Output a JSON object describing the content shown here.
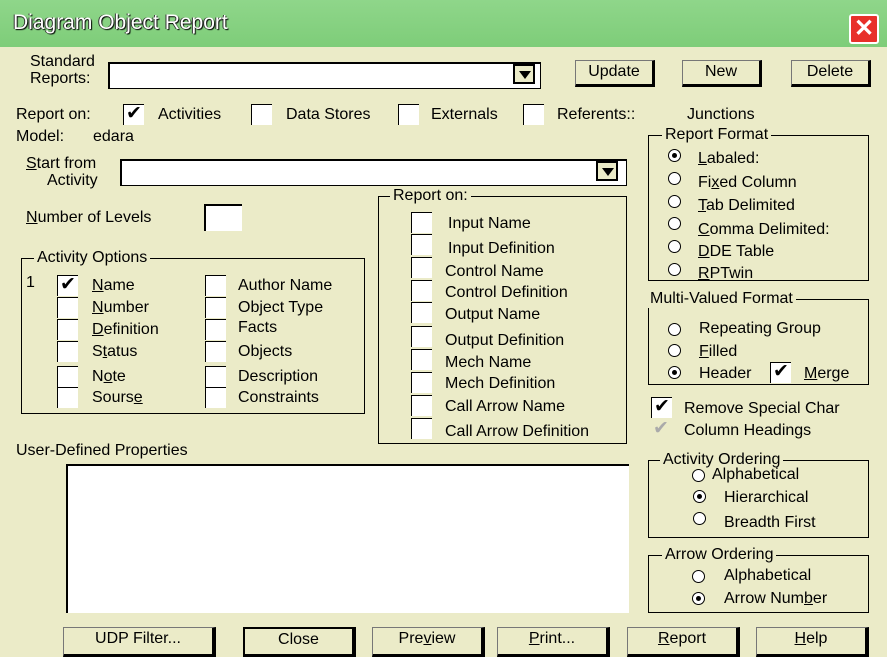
{
  "window": {
    "title": "Diagram Object Report",
    "close": "✕"
  },
  "standard_reports": {
    "label1": "Standard",
    "label2": "Reports:",
    "value": ""
  },
  "buttons_top": {
    "update": "Update",
    "new": "New",
    "delete": "Delete"
  },
  "report_on_row": {
    "label": "Report on:",
    "activities": "Activities",
    "data_stores": "Data Stores",
    "externals": "Externals",
    "referents": "Referents::",
    "junctions": "Junctions"
  },
  "model": {
    "label": "Model:",
    "value": "edara"
  },
  "start_from": {
    "label1": "Start from",
    "label2": "Activity",
    "value": ""
  },
  "levels": {
    "label": "Number of Levels",
    "value": ""
  },
  "activity_options": {
    "legend": "Activity Options",
    "marker": "1",
    "left": [
      "Name",
      "Number",
      "Definition",
      "Status",
      "Note",
      "Sourse"
    ],
    "right": [
      "Author Name",
      "Object Type",
      "Facts",
      "Objects",
      "Description",
      "Constraints"
    ]
  },
  "report_on_box": {
    "legend": "Report on:",
    "items": [
      "Input Name",
      "Input Definition",
      "Control Name",
      "Control Definition",
      "Output Name",
      "Output Definition",
      "Mech Name",
      "Mech Definition",
      "Call Arrow Name",
      "Call Arrow Definition"
    ]
  },
  "report_format": {
    "legend": "Report Format",
    "options": [
      "Labaled:",
      "Fixed Column",
      "Tab Delimited",
      "Comma Delimited:",
      "DDE Table",
      "RPTwin"
    ],
    "selected": 0
  },
  "multi_valued": {
    "legend": "Multi-Valued Format",
    "options": [
      "Repeating Group",
      "Filled",
      "Header"
    ],
    "merge": "Merge"
  },
  "remove_special": "Remove Special Char",
  "column_headings": "Column Headings",
  "activity_ordering": {
    "legend": "Activity Ordering",
    "options": [
      "Alphabetical",
      "Hierarchical",
      "Breadth First"
    ]
  },
  "arrow_ordering": {
    "legend": "Arrow Ordering",
    "options": [
      "Alphabetical",
      "Arrow Number"
    ]
  },
  "udp": {
    "label": "User-Defined Properties"
  },
  "bottom_buttons": {
    "udp_filter": "UDP Filter...",
    "close": "Close",
    "preview": "Preview",
    "print": "Print...",
    "report": "Report",
    "help": "Help"
  },
  "colors": {
    "background": "#EBEBC8",
    "titlebar": "#7ECD79",
    "close_button": "#E8302A"
  }
}
